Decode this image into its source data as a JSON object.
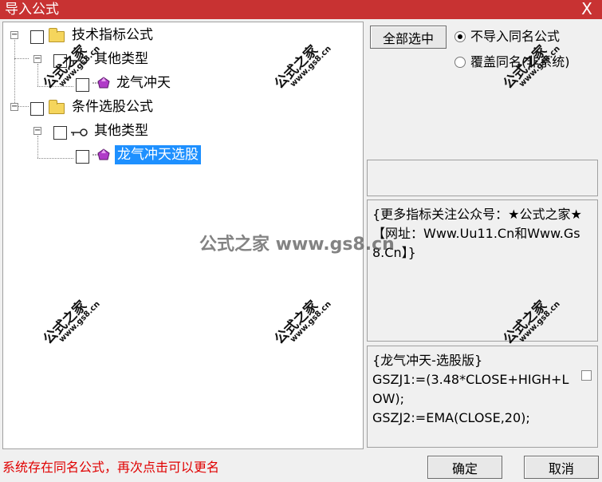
{
  "window": {
    "title": "导入公式",
    "close_glyph": "X"
  },
  "tree": {
    "groups": [
      {
        "label": "技术指标公式",
        "child_label": "其他类型",
        "leaf_label": "龙气冲天"
      },
      {
        "label": "条件选股公式",
        "child_label": "其他类型",
        "leaf_label": "龙气冲天选股"
      }
    ],
    "expander_glyph": "−"
  },
  "actions": {
    "select_all_label": "全部选中",
    "radio_no_import_label": "不导入同名公式",
    "radio_overwrite_label": "覆盖同名(非系统)",
    "selected_radio": "no_import"
  },
  "description": {
    "text": "{更多指标关注公众号：★公式之家★【网址：Www.Uu11.Cn和Www.Gs8.Cn】}"
  },
  "code": {
    "lines": [
      "{龙气冲天-选股版}",
      "GSZJ1:=(3.48*CLOSE+HIGH+LOW);",
      "GSZJ2:=EMA(CLOSE,20);"
    ]
  },
  "status": {
    "message": "系统存在同名公式，再次点击可以更名"
  },
  "footer": {
    "ok_label": "确定",
    "cancel_label": "取消"
  },
  "watermark": {
    "main": "公式之家",
    "sub": "www.gs8.cn",
    "center": "公式之家 www.gs8.cn"
  },
  "colors": {
    "titlebar": "#c83232",
    "selection": "#1e90ff",
    "status": "#e00000",
    "folder": "#f5d55c",
    "gem": "#b03ac8"
  }
}
